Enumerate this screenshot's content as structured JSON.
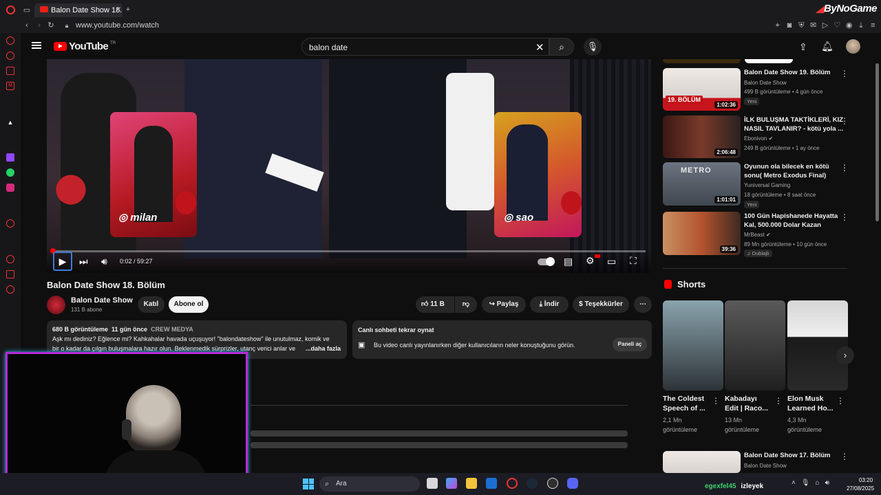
{
  "browser": {
    "tab_title": "Balon Date Show 18. Bölüm",
    "url": "www.youtube.com/watch",
    "watermark": "ByNoGame"
  },
  "header": {
    "logo_text": "YouTube",
    "logo_region": "TR",
    "search_value": "balon date"
  },
  "player": {
    "time": "0:02 / 59:27",
    "progress_fraction": 0.0006,
    "card_left_handle": "milan",
    "card_right_handle": "sao"
  },
  "video": {
    "title": "Balon Date Show 18. Bölüm",
    "channel_name": "Balon Date Show",
    "subscribers": "131 B abone",
    "join_label": "Katıl",
    "subscribe_label": "Abone ol",
    "likes": "11 B",
    "share_label": "Paylaş",
    "download_label": "İndir",
    "thanks_label": "Teşekkürler"
  },
  "description": {
    "views": "680 B görüntüleme",
    "date": "11 gün önce",
    "tag": "CREW MEDYA",
    "line1": "Aşk mı dediniz? Eğlence mi? Kahkahalar havada uçuşuyor! \"balondateshow\" ile unutulmaz, komik ve",
    "line2": "bir o kadar da çılgın buluşmalara hazır olun. Beklenmedik sürprizler, utanç verici anlar ve",
    "more": "...daha fazla"
  },
  "chat": {
    "title": "Canlı sohbeti tekrar oynat",
    "text": "Bu video canlı yayınlanırken diğer kullanıcıların neler konuştuğunu görün.",
    "button": "Paneli aç"
  },
  "sidebar": {
    "items": [
      {
        "title1": "Balon Date Show 19. Bölüm",
        "title2": "",
        "channel": "Balon Date Show",
        "meta": "499 B görüntüleme • 4 gün önce",
        "duration": "1:02:36",
        "badge": "Yeni",
        "thumb_text": "19. BÖLÜM"
      },
      {
        "title1": "İLK BULUŞMA TAKTİKLERİ, KIZ",
        "title2": "NASIL TAVLANIR? - kötü yola ...",
        "channel": "Ebonivon",
        "meta": "249 B görüntüleme • 1 ay önce",
        "duration": "2:06:48",
        "badge": "",
        "thumb_text": ""
      },
      {
        "title1": "Oyunun ola bilecek en kötü",
        "title2": "sonu( Metro Exodus Final)",
        "channel": "Yuniversal Gaming",
        "meta": "18 görüntüleme • 8 saat önce",
        "duration": "1:01:01",
        "badge": "Yeni",
        "thumb_text": "METRO"
      },
      {
        "title1": "100 Gün Hapishanede Hayatta",
        "title2": "Kal, 500.000 Dolar Kazan",
        "channel": "MrBeast",
        "meta": "89 Mn görüntüleme • 10 gün önce",
        "duration": "39:36",
        "badge": "Dublajlı",
        "thumb_text": ""
      }
    ],
    "shorts_heading": "Shorts",
    "shorts": [
      {
        "title1": "The Coldest",
        "title2": "Speech of ...",
        "views1": "2,1 Mn",
        "views2": "görüntüleme"
      },
      {
        "title1": "Kabadayı",
        "title2": "Edit | Raco...",
        "views1": "13 Mn",
        "views2": "görüntüleme"
      },
      {
        "title1": "Elon Musk",
        "title2": "Learned Ho...",
        "views1": "4,3 Mn",
        "views2": "görüntüleme"
      }
    ],
    "bottom_item": {
      "title": "Balon Date Show 17. Bölüm",
      "channel": "Balon Date Show"
    }
  },
  "taskbar": {
    "search_placeholder": "Ara",
    "overlay_user": "egexfel45",
    "overlay_action": "izleyek",
    "time": "03:20",
    "date": "27/08/2025"
  },
  "colors": {
    "accent": "#ff0000",
    "bg": "#0f0f0f",
    "surface": "#272727"
  }
}
